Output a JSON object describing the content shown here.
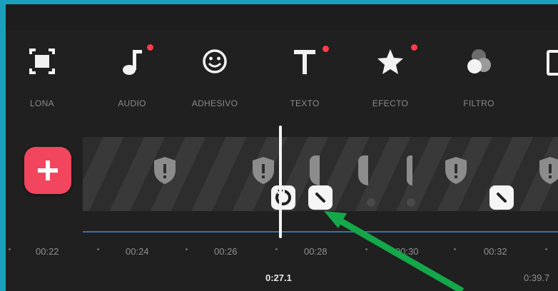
{
  "toolbar": {
    "items": [
      {
        "label": "LONA",
        "icon": "canvas-frame-icon",
        "new": false
      },
      {
        "label": "AUDIO",
        "icon": "music-note-icon",
        "new": true
      },
      {
        "label": "ADHESIVO",
        "icon": "smiley-icon",
        "new": false
      },
      {
        "label": "TEXTO",
        "icon": "text-t-icon",
        "new": true
      },
      {
        "label": "EFECTO",
        "icon": "star-icon",
        "new": true
      },
      {
        "label": "FILTRO",
        "icon": "filter-circles-icon",
        "new": false
      }
    ]
  },
  "timeline": {
    "ticks": [
      "00:22",
      "00:24",
      "00:26",
      "00:28",
      "00:30",
      "00:32"
    ],
    "current_time": "0:27.1",
    "total_time": "0:39.7"
  },
  "colors": {
    "add_button": "#f2465e",
    "new_dot": "#ff3b4c",
    "arrow": "#14a84a",
    "border": "#1aa0bd"
  }
}
